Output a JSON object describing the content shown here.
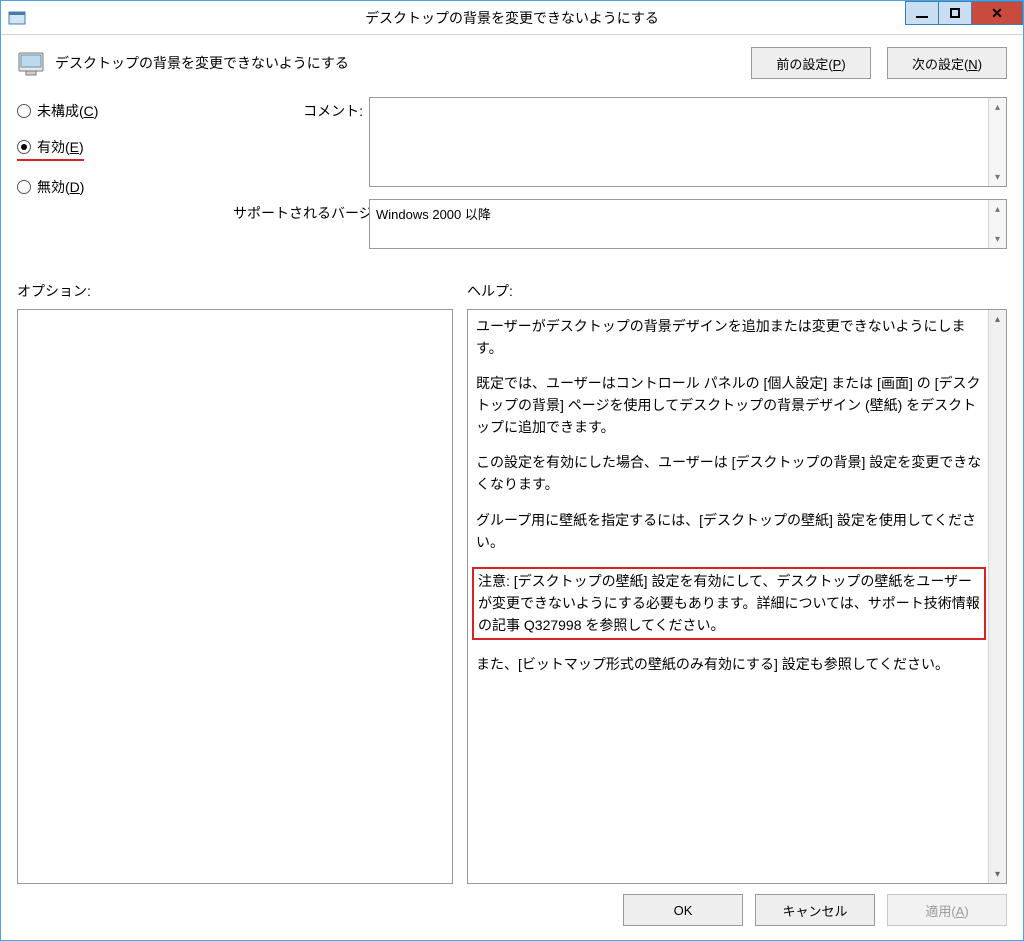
{
  "titlebar": {
    "title": "デスクトップの背景を変更できないようにする"
  },
  "header": {
    "policy_title": "デスクトップの背景を変更できないようにする",
    "prev_label": "前の設定(P)",
    "next_label": "次の設定(N)"
  },
  "radios": {
    "not_configured": "未構成(C)",
    "enabled": "有効(E)",
    "disabled": "無効(D)"
  },
  "labels": {
    "comment": "コメント:",
    "supported": "サポートされるバージョン:",
    "options": "オプション:",
    "help": "ヘルプ:"
  },
  "fields": {
    "comment_value": "",
    "supported_value": "Windows 2000 以降"
  },
  "help": {
    "p1": "ユーザーがデスクトップの背景デザインを追加または変更できないようにします。",
    "p2": "既定では、ユーザーはコントロール パネルの [個人設定] または [画面] の [デスクトップの背景] ページを使用してデスクトップの背景デザイン (壁紙) をデスクトップに追加できます。",
    "p3": "この設定を有効にした場合、ユーザーは [デスクトップの背景] 設定を変更できなくなります。",
    "p4": "グループ用に壁紙を指定するには、[デスクトップの壁紙] 設定を使用してください。",
    "p5_note": "注意: [デスクトップの壁紙] 設定を有効にして、デスクトップの壁紙をユーザーが変更できないようにする必要もあります。詳細については、サポート技術情報の記事 Q327998 を参照してください。",
    "p6": "また、[ビットマップ形式の壁紙のみ有効にする] 設定も参照してください。"
  },
  "buttons": {
    "ok": "OK",
    "cancel": "キャンセル",
    "apply": "適用(A)"
  }
}
